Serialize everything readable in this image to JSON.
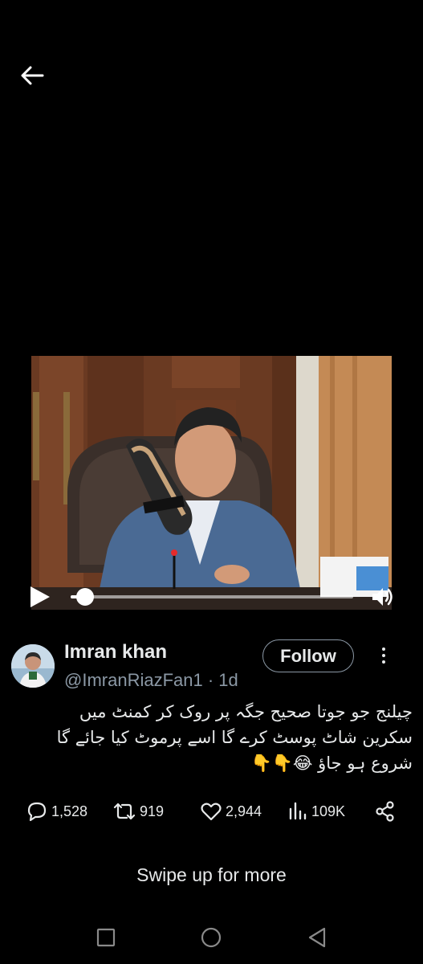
{
  "icons": {
    "back": "arrow-left-icon",
    "play": "play-icon",
    "volume": "volume-icon",
    "more": "more-vertical-icon",
    "reply": "comment-icon",
    "retweet": "retweet-icon",
    "like": "heart-icon",
    "views": "views-icon",
    "share": "share-icon",
    "nav_recents": "square-icon",
    "nav_home": "circle-icon",
    "nav_back": "triangle-back-icon"
  },
  "video": {
    "progress": 0.05
  },
  "author": {
    "name": "Imran khan",
    "handle": "@ImranRiazFan1 · 1d",
    "follow_label": "Follow"
  },
  "tweet": {
    "lines": [
      "چیلنج جو جوتا صحیح جگہ پر روک کر کمنٹ میں",
      "سکرین شاٹ پوسٹ کرے گا اسے پرموٹ کیا جائے گا",
      "شروع ہو جاؤ 😂👇👇"
    ]
  },
  "actions": {
    "replies": "1,528",
    "retweets": "919",
    "likes": "2,944",
    "views": "109K"
  },
  "swipe_hint": "Swipe up for more",
  "colors": {
    "background": "#000000",
    "text": "#e7e9ea",
    "muted": "#8b98a5"
  }
}
